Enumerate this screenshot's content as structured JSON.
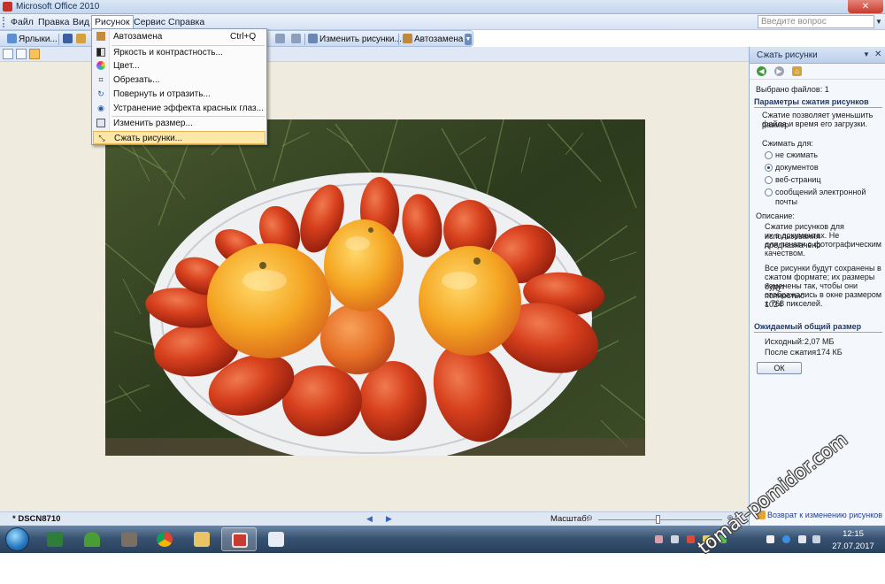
{
  "window": {
    "title": "Microsoft Office 2010",
    "close_label": "✕"
  },
  "menubar": {
    "items": [
      "Файл",
      "Правка",
      "Вид",
      "Рисунок",
      "Сервис",
      "Справка"
    ],
    "help_placeholder": "Введите вопрос"
  },
  "toolbar": {
    "shortcuts_label": "Ярлыки...",
    "edit_pictures_label": "Изменить рисунки...",
    "autocorrect_label": "Автозамена"
  },
  "dropdown": {
    "items": [
      {
        "label": "Автозамена",
        "shortcut": "Ctrl+Q",
        "icon": "autocorrect-icon"
      },
      {
        "label": "Яркость и контрастность...",
        "icon": "brightness-icon"
      },
      {
        "label": "Цвет...",
        "icon": "color-icon"
      },
      {
        "label": "Обрезать...",
        "icon": "crop-icon"
      },
      {
        "label": "Повернуть и отразить...",
        "icon": "rotate-icon"
      },
      {
        "label": "Устранение эффекта красных глаз...",
        "icon": "red-eye-icon"
      },
      {
        "label": "Изменить размер...",
        "icon": "resize-icon"
      },
      {
        "label": "Сжать рисунки...",
        "icon": "compress-icon",
        "highlighted": true
      }
    ]
  },
  "statusbar": {
    "filename": "* DSCN8710",
    "zoom_label": "Масштаб:",
    "zoom_level": 0.48
  },
  "taskpane": {
    "title": "Сжать рисунки",
    "selected_files": "Выбрано файлов: 1",
    "section_params": "Параметры сжатия рисунков",
    "params_text": [
      "Сжатие позволяет уменьшить размер",
      "файла и время его загрузки."
    ],
    "compress_for": "Сжимать для:",
    "options": [
      {
        "label": "не сжимать",
        "selected": false
      },
      {
        "label": "документов",
        "selected": true
      },
      {
        "label": "веб-страниц",
        "selected": false
      },
      {
        "label": "сообщений электронной почты",
        "selected": false
      }
    ],
    "description_label": "Описание:",
    "description_lines": [
      "Сжатие рисунков для использования",
      "их в документах. Не предназначено",
      "для печати с фотографическим",
      "качеством.",
      "",
      "Все рисунки будут сохранены в",
      "сжатом формате; их размеры будут",
      "изменены так, чтобы они полностью",
      "отображались в окне размером 1024",
      "x 768 пикселей."
    ],
    "section_expected": "Ожидаемый общий размер",
    "original_label": "Исходный:",
    "original_value": "2,07 МБ",
    "after_label": "После сжатия:",
    "after_value": "174 КБ",
    "ok_label": "ОК",
    "back_link": "Возврат к изменению рисунков"
  },
  "taskbar": {
    "time": "12:15",
    "date": "27.07.2017"
  },
  "watermark": "tomat-pomidor.com"
}
